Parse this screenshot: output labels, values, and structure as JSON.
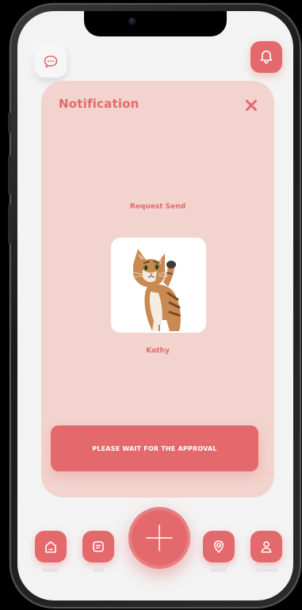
{
  "notification": {
    "title": "Notification",
    "message": "Request Send",
    "pet_name": "Kathy",
    "status_button": "PLEASE WAIT FOR THE APPROVAL"
  },
  "icons": {
    "chat": "chat-bubble-icon",
    "bell": "bell-icon",
    "close": "close-icon",
    "add": "plus-icon"
  },
  "nav": {
    "items": [
      {
        "label": "home",
        "icon": "home-icon"
      },
      {
        "label": "info",
        "icon": "info-icon"
      },
      {
        "label": "world",
        "icon": "location-pin-icon"
      },
      {
        "label": "account",
        "icon": "user-icon"
      }
    ]
  },
  "colors": {
    "accent": "#e4696d",
    "card": "#f2d3cd",
    "background": "#f3f3f3"
  }
}
